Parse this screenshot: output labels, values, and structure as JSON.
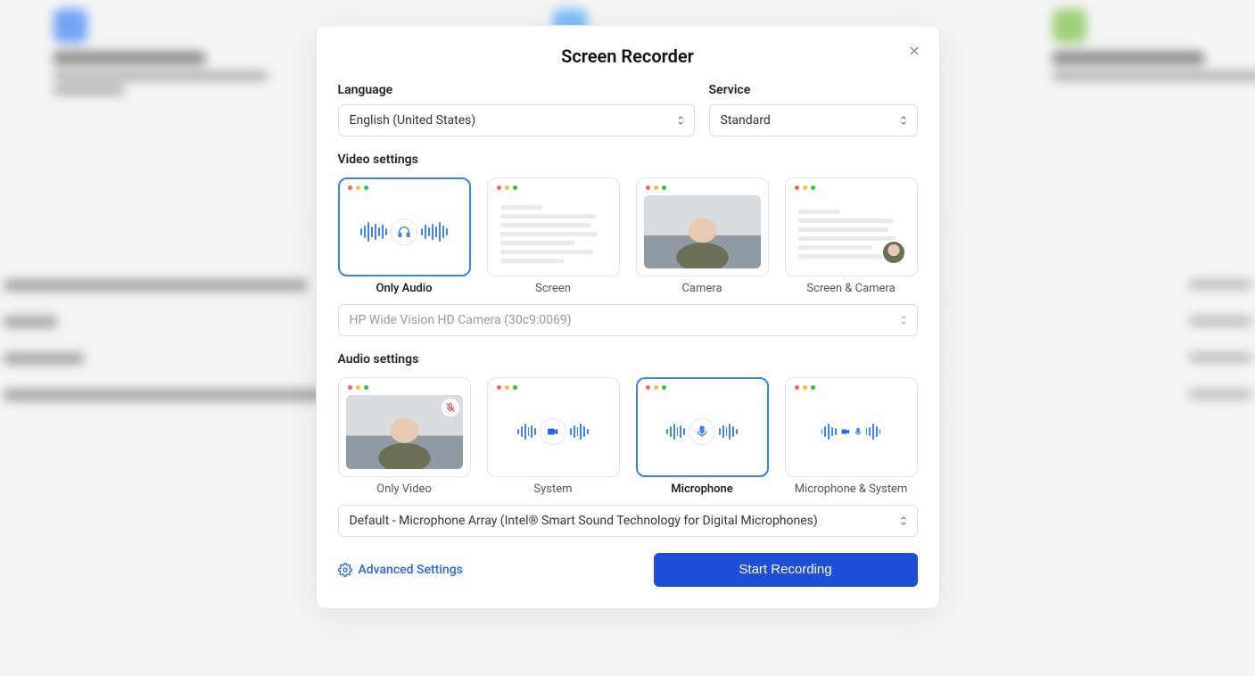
{
  "modal": {
    "title": "Screen Recorder",
    "language_label": "Language",
    "language_value": "English (United States)",
    "service_label": "Service",
    "service_value": "Standard",
    "video_settings_label": "Video settings",
    "video_options": {
      "only_audio": "Only Audio",
      "screen": "Screen",
      "camera": "Camera",
      "screen_camera": "Screen & Camera"
    },
    "video_selected": "only_audio",
    "camera_select_value": "HP Wide Vision HD Camera (30c9:0069)",
    "audio_settings_label": "Audio settings",
    "audio_options": {
      "only_video": "Only Video",
      "system": "System",
      "microphone": "Microphone",
      "mic_system": "Microphone & System"
    },
    "audio_selected": "microphone",
    "mic_select_value": "Default - Microphone Array (Intel® Smart Sound Technology for Digital Microphones)",
    "advanced_settings": "Advanced Settings",
    "start_button": "Start Recording"
  }
}
